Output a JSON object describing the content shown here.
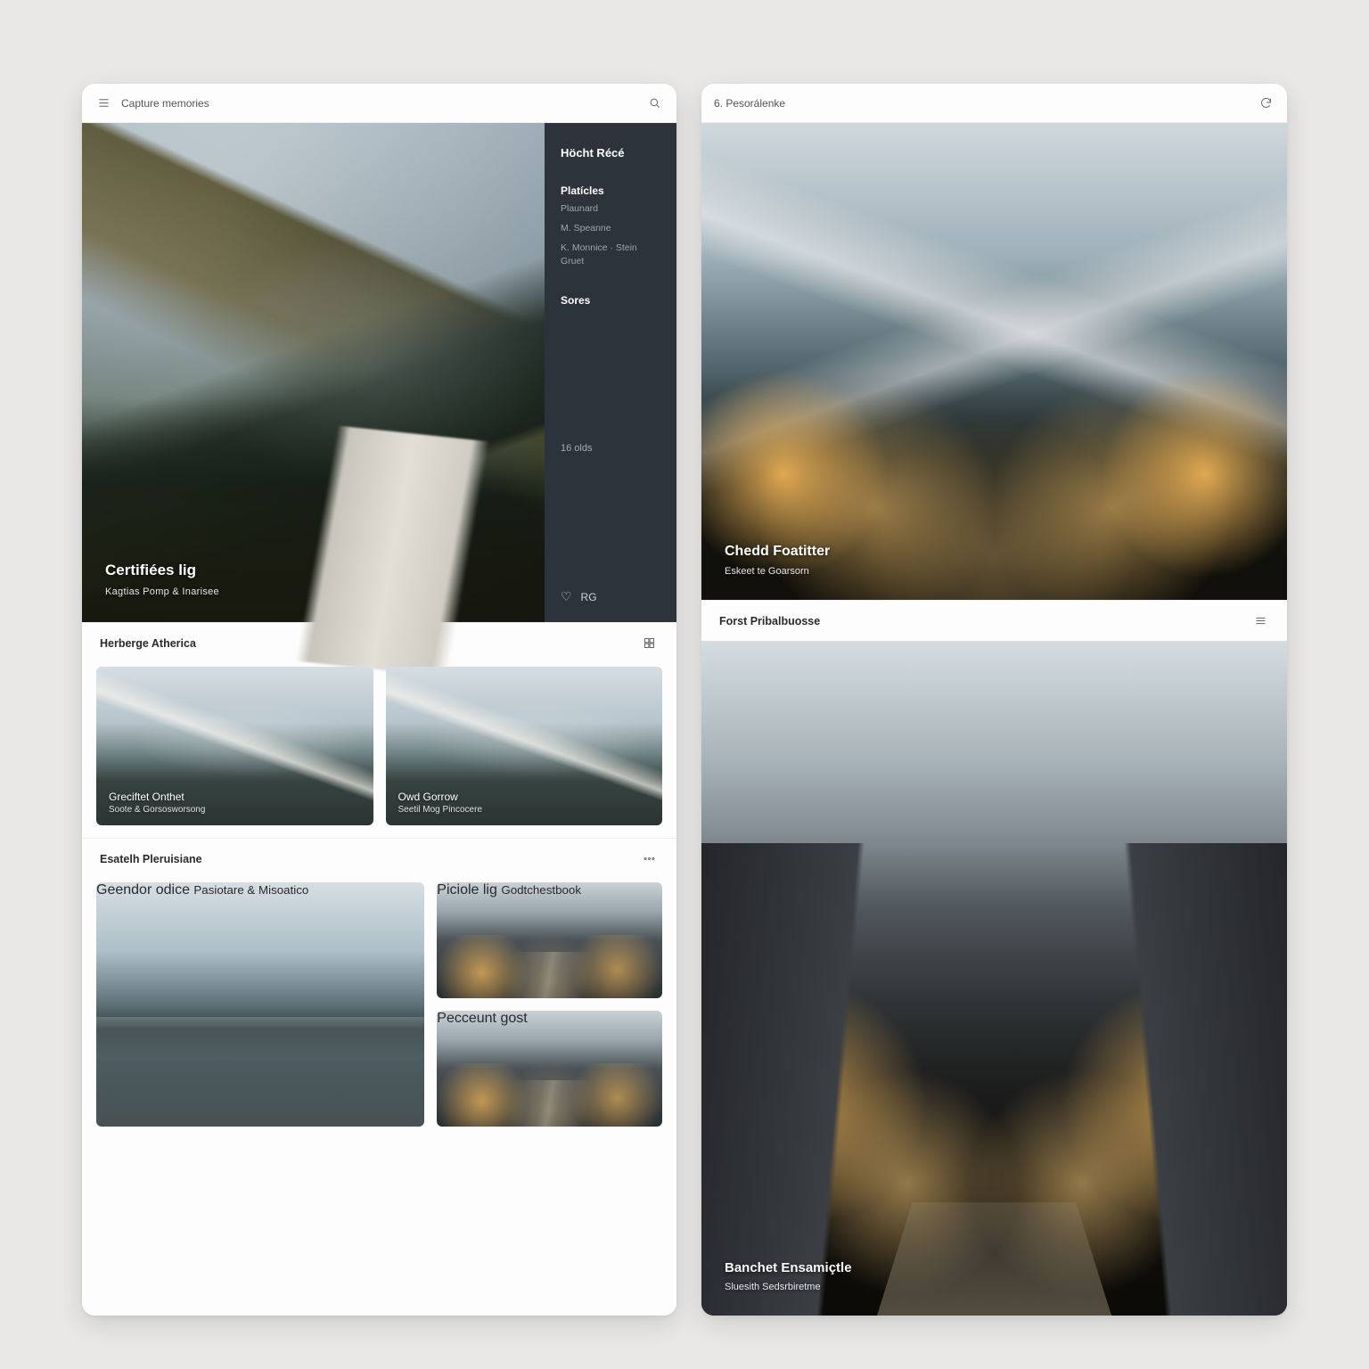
{
  "left": {
    "topbar": {
      "title": "Capture memories"
    },
    "hero": {
      "title": "Certifiées lig",
      "subtitle": "Kagtias Pomp & Inarisee"
    },
    "side": {
      "heading": "Höcht Récé",
      "block_title": "Platícles",
      "block_lines": [
        "Plaunard",
        "M. Speanne",
        "K. Monnice · Stein Gruet"
      ],
      "group_label": "Sores",
      "footer_label": "16 olds",
      "like_label": "RG"
    },
    "section1": {
      "title": "Herberge Atherica"
    },
    "thumbs1": [
      {
        "title": "Greciftet Onthet",
        "sub": "Soote & Gorsosworsong"
      },
      {
        "title": "Owd Gorrow",
        "sub": "Seetil Mog Pincocere"
      }
    ],
    "section2": {
      "title": "Esatelh Pleruisiane"
    },
    "big": {
      "title": "Geendor odice",
      "sub": "Pasiotare & Misoatico"
    },
    "stack": [
      {
        "title": "Piciole lig",
        "sub": "Godtchestbook"
      },
      {
        "title": "Pecceunt gost",
        "sub": ""
      }
    ]
  },
  "right": {
    "topbar": {
      "title": "6. Pesorálenke"
    },
    "hero": {
      "title": "Chedd Foatitter",
      "sub": "Eskeet te Goarsorn"
    },
    "section": {
      "title": "Forst Pribalbuosse"
    },
    "feature": {
      "title": "Banchet Ensamiçtle",
      "sub": "Sluesith Sedsrbiretme"
    }
  }
}
